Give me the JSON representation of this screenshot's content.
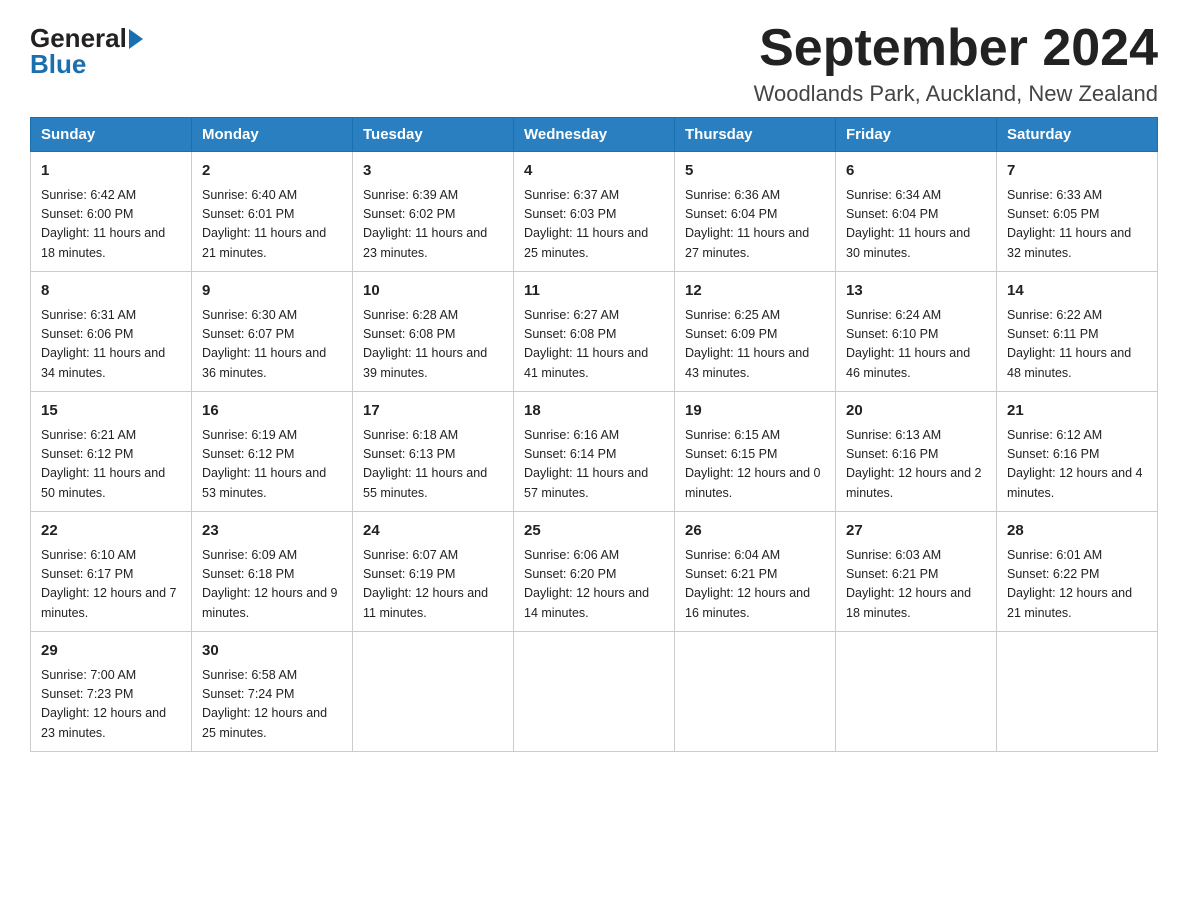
{
  "logo": {
    "general": "General",
    "blue": "Blue"
  },
  "title": "September 2024",
  "subtitle": "Woodlands Park, Auckland, New Zealand",
  "days_of_week": [
    "Sunday",
    "Monday",
    "Tuesday",
    "Wednesday",
    "Thursday",
    "Friday",
    "Saturday"
  ],
  "weeks": [
    [
      {
        "day": "1",
        "sunrise": "6:42 AM",
        "sunset": "6:00 PM",
        "daylight": "11 hours and 18 minutes."
      },
      {
        "day": "2",
        "sunrise": "6:40 AM",
        "sunset": "6:01 PM",
        "daylight": "11 hours and 21 minutes."
      },
      {
        "day": "3",
        "sunrise": "6:39 AM",
        "sunset": "6:02 PM",
        "daylight": "11 hours and 23 minutes."
      },
      {
        "day": "4",
        "sunrise": "6:37 AM",
        "sunset": "6:03 PM",
        "daylight": "11 hours and 25 minutes."
      },
      {
        "day": "5",
        "sunrise": "6:36 AM",
        "sunset": "6:04 PM",
        "daylight": "11 hours and 27 minutes."
      },
      {
        "day": "6",
        "sunrise": "6:34 AM",
        "sunset": "6:04 PM",
        "daylight": "11 hours and 30 minutes."
      },
      {
        "day": "7",
        "sunrise": "6:33 AM",
        "sunset": "6:05 PM",
        "daylight": "11 hours and 32 minutes."
      }
    ],
    [
      {
        "day": "8",
        "sunrise": "6:31 AM",
        "sunset": "6:06 PM",
        "daylight": "11 hours and 34 minutes."
      },
      {
        "day": "9",
        "sunrise": "6:30 AM",
        "sunset": "6:07 PM",
        "daylight": "11 hours and 36 minutes."
      },
      {
        "day": "10",
        "sunrise": "6:28 AM",
        "sunset": "6:08 PM",
        "daylight": "11 hours and 39 minutes."
      },
      {
        "day": "11",
        "sunrise": "6:27 AM",
        "sunset": "6:08 PM",
        "daylight": "11 hours and 41 minutes."
      },
      {
        "day": "12",
        "sunrise": "6:25 AM",
        "sunset": "6:09 PM",
        "daylight": "11 hours and 43 minutes."
      },
      {
        "day": "13",
        "sunrise": "6:24 AM",
        "sunset": "6:10 PM",
        "daylight": "11 hours and 46 minutes."
      },
      {
        "day": "14",
        "sunrise": "6:22 AM",
        "sunset": "6:11 PM",
        "daylight": "11 hours and 48 minutes."
      }
    ],
    [
      {
        "day": "15",
        "sunrise": "6:21 AM",
        "sunset": "6:12 PM",
        "daylight": "11 hours and 50 minutes."
      },
      {
        "day": "16",
        "sunrise": "6:19 AM",
        "sunset": "6:12 PM",
        "daylight": "11 hours and 53 minutes."
      },
      {
        "day": "17",
        "sunrise": "6:18 AM",
        "sunset": "6:13 PM",
        "daylight": "11 hours and 55 minutes."
      },
      {
        "day": "18",
        "sunrise": "6:16 AM",
        "sunset": "6:14 PM",
        "daylight": "11 hours and 57 minutes."
      },
      {
        "day": "19",
        "sunrise": "6:15 AM",
        "sunset": "6:15 PM",
        "daylight": "12 hours and 0 minutes."
      },
      {
        "day": "20",
        "sunrise": "6:13 AM",
        "sunset": "6:16 PM",
        "daylight": "12 hours and 2 minutes."
      },
      {
        "day": "21",
        "sunrise": "6:12 AM",
        "sunset": "6:16 PM",
        "daylight": "12 hours and 4 minutes."
      }
    ],
    [
      {
        "day": "22",
        "sunrise": "6:10 AM",
        "sunset": "6:17 PM",
        "daylight": "12 hours and 7 minutes."
      },
      {
        "day": "23",
        "sunrise": "6:09 AM",
        "sunset": "6:18 PM",
        "daylight": "12 hours and 9 minutes."
      },
      {
        "day": "24",
        "sunrise": "6:07 AM",
        "sunset": "6:19 PM",
        "daylight": "12 hours and 11 minutes."
      },
      {
        "day": "25",
        "sunrise": "6:06 AM",
        "sunset": "6:20 PM",
        "daylight": "12 hours and 14 minutes."
      },
      {
        "day": "26",
        "sunrise": "6:04 AM",
        "sunset": "6:21 PM",
        "daylight": "12 hours and 16 minutes."
      },
      {
        "day": "27",
        "sunrise": "6:03 AM",
        "sunset": "6:21 PM",
        "daylight": "12 hours and 18 minutes."
      },
      {
        "day": "28",
        "sunrise": "6:01 AM",
        "sunset": "6:22 PM",
        "daylight": "12 hours and 21 minutes."
      }
    ],
    [
      {
        "day": "29",
        "sunrise": "7:00 AM",
        "sunset": "7:23 PM",
        "daylight": "12 hours and 23 minutes."
      },
      {
        "day": "30",
        "sunrise": "6:58 AM",
        "sunset": "7:24 PM",
        "daylight": "12 hours and 25 minutes."
      },
      null,
      null,
      null,
      null,
      null
    ]
  ],
  "labels": {
    "sunrise": "Sunrise:",
    "sunset": "Sunset:",
    "daylight": "Daylight:"
  }
}
